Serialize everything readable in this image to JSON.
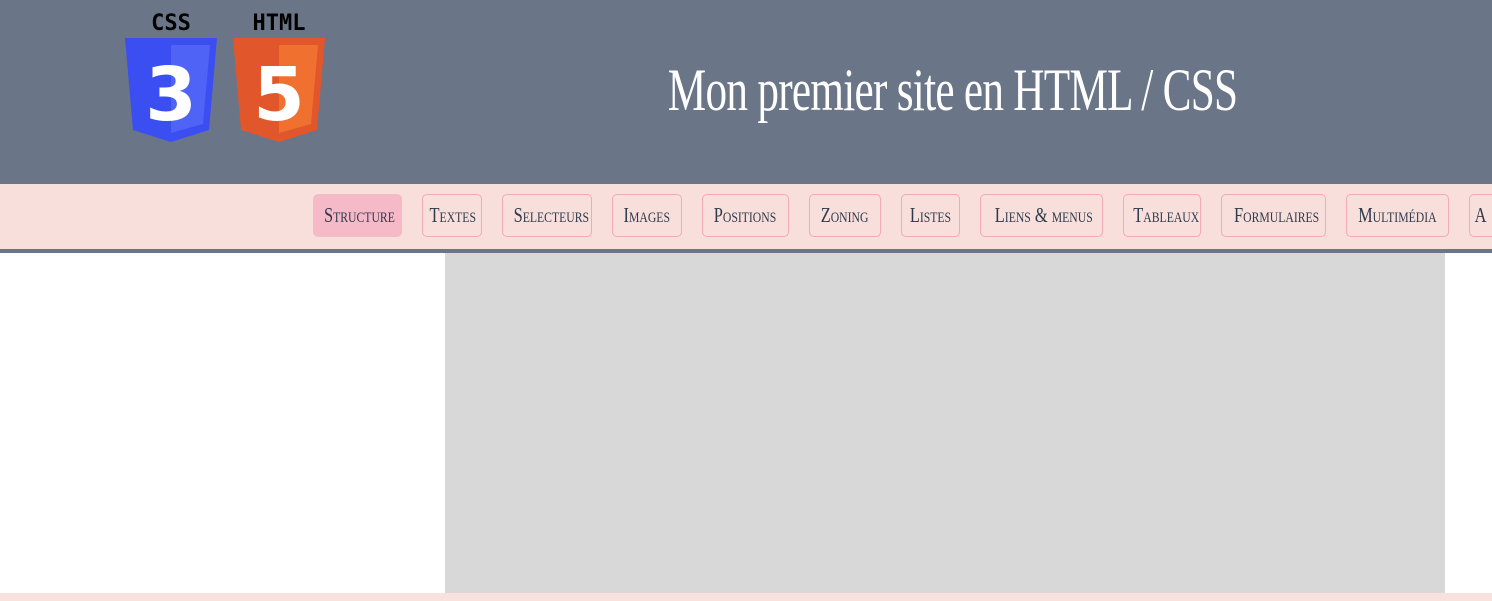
{
  "header": {
    "title": "Mon premier site en HTML / CSS",
    "logos": [
      {
        "label": "CSS",
        "digit": "3",
        "color": "#3b4ef1"
      },
      {
        "label": "HTML",
        "digit": "5",
        "color": "#e2562b"
      }
    ]
  },
  "nav": {
    "items": [
      {
        "label": "Structure",
        "active": true
      },
      {
        "label": "Textes"
      },
      {
        "label": "Selecteurs"
      },
      {
        "label": "Images"
      },
      {
        "label": "Positions"
      },
      {
        "label": "Zoning"
      },
      {
        "label": "Listes"
      },
      {
        "label": "Liens & menus"
      },
      {
        "label": "Tableaux"
      },
      {
        "label": "Formulaires"
      },
      {
        "label": "Multimédia"
      },
      {
        "label": "A"
      }
    ]
  },
  "colors": {
    "header_bg": "#6a7587",
    "nav_bg": "#f9dfdc",
    "nav_border": "#f3a9b8",
    "nav_active": "#f6b9c8",
    "content_bg": "#d8d8d8"
  }
}
